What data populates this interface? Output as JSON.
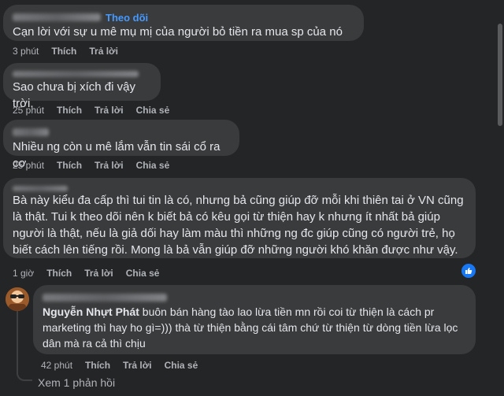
{
  "comments": [
    {
      "follow_label": "Theo dõi",
      "text": "Cạn lời với sự u mê mụ mị của người bỏ tiền ra mua sp của nó",
      "time": "3 phút",
      "like": "Thích",
      "reply": "Trả lời"
    },
    {
      "text": "Sao chưa bị xích đi vậy trời.",
      "time": "25 phút",
      "like": "Thích",
      "reply": "Trả lời",
      "share": "Chia sẻ"
    },
    {
      "text": "Nhiều ng còn u mê lắm vẫn tin sái cổ ra cơ",
      "time": "25 phút",
      "like": "Thích",
      "reply": "Trả lời",
      "share": "Chia sẻ"
    },
    {
      "text": "Bà này kiểu đa cấp thì tui tin là có, nhưng bả cũng giúp đỡ mỗi khi thiên tai ở VN cũng là thật. Tui k theo dõi nên k biết bả có kêu gọi từ thiện hay k nhưng ít nhất bả giúp người là thật, nếu là giả dối hay làm màu thì những ng đc giúp cũng có người trẻ, họ biết cách lên tiếng rồi. Mong là bả vẫn giúp đỡ những người khó khăn được như vậy.",
      "time": "1 giờ",
      "like": "Thích",
      "reply": "Trả lời",
      "share": "Chia sẻ"
    }
  ],
  "reply": {
    "mention": "Nguyễn Nhựt Phát",
    "text": " buôn bán hàng tào lao lừa tiền mn rồi coi từ thiện là cách pr marketing thì hay ho gì=))) thà từ thiện bằng cái tâm chứ từ thiện từ dòng tiền lừa lọc dân mà ra cả thì chịu",
    "time": "42 phút",
    "like": "Thích",
    "reply": "Trả lời",
    "share": "Chia sẻ"
  },
  "view_more_replies": "Xem 1 phản hồi",
  "colors": {
    "background": "#242526",
    "bubble": "#3a3b3c",
    "accent": "#4599ff",
    "like_blue": "#1877f2"
  }
}
